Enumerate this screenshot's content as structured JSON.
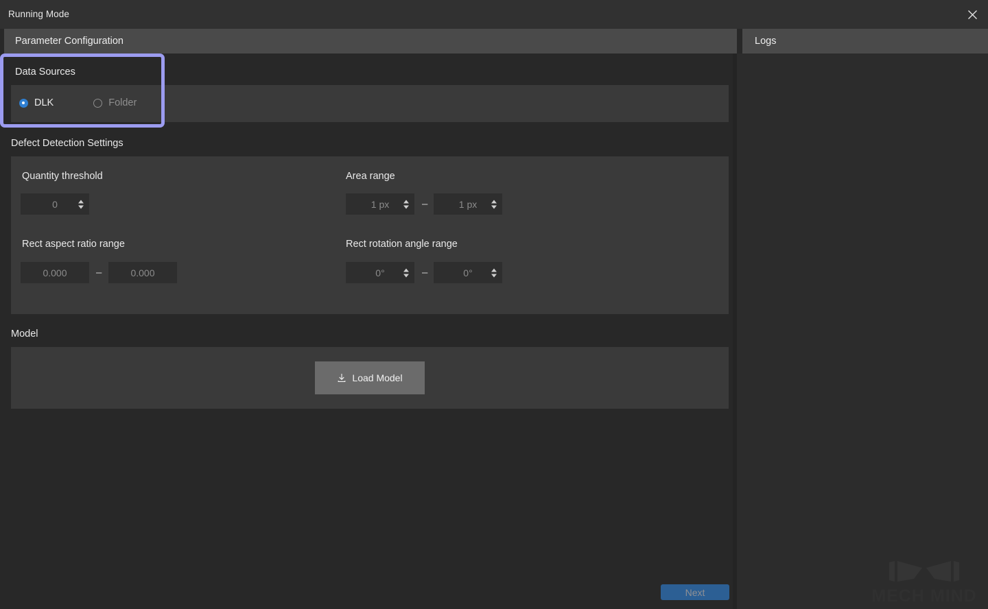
{
  "window": {
    "title": "Running Mode",
    "close_icon": "close-icon"
  },
  "tabs": {
    "left": "Parameter Configuration",
    "right": "Logs"
  },
  "data_sources": {
    "heading": "Data Sources",
    "options": [
      {
        "label": "DLK",
        "selected": true
      },
      {
        "label": "Folder",
        "selected": false
      }
    ]
  },
  "defect_detection": {
    "heading": "Defect Detection Settings",
    "quantity_threshold": {
      "label": "Quantity threshold",
      "value": "0"
    },
    "area_range": {
      "label": "Area range",
      "min": "1 px",
      "max": "1 px",
      "separator": "–"
    },
    "rect_aspect_ratio_range": {
      "label": "Rect aspect ratio range",
      "min": "0.000",
      "max": "0.000",
      "separator": "–"
    },
    "rect_rotation_angle_range": {
      "label": "Rect rotation angle range",
      "min": "0°",
      "max": "0°",
      "separator": "–"
    }
  },
  "model": {
    "heading": "Model",
    "load_button": {
      "label": "Load Model",
      "icon": "download-icon"
    }
  },
  "footer": {
    "next_label": "Next"
  },
  "watermark": {
    "text": "MECH MIND"
  },
  "colors": {
    "window_background": "#282828",
    "titlebar": "#313131",
    "tab_header": "#4a4a4a",
    "card": "#3a3a3a",
    "input": "#2e2e2e",
    "accent_blue": "#2f7fd1",
    "next_button": "#2c5f94",
    "highlight_border": "#9c9cf0",
    "load_button": "#6b6b6b"
  }
}
